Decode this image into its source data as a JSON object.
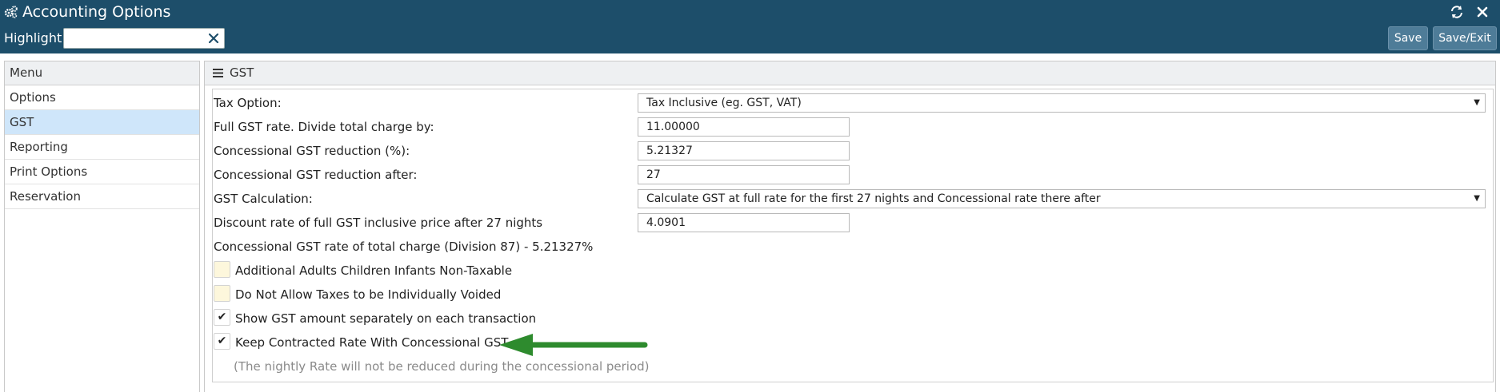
{
  "window": {
    "title": "Accounting Options",
    "title_icon": "gears-icon",
    "refresh_icon": "refresh-icon",
    "close_icon": "close-icon"
  },
  "toolbar": {
    "highlight_label": "Highlight:",
    "highlight_value": "",
    "save_label": "Save",
    "save_exit_label": "Save/Exit"
  },
  "menu": {
    "header": "Menu",
    "items": [
      {
        "label": "Options"
      },
      {
        "label": "GST"
      },
      {
        "label": "Reporting"
      },
      {
        "label": "Print Options"
      },
      {
        "label": "Reservation"
      }
    ],
    "active_index": 1
  },
  "gst": {
    "header": "GST",
    "tax_option": {
      "label": "Tax Option:",
      "value": "Tax Inclusive (eg. GST, VAT)"
    },
    "full_rate": {
      "label": "Full GST rate. Divide total charge by:",
      "value": "11.00000"
    },
    "concessional_reduction": {
      "label": "Concessional GST reduction (%):",
      "value": "5.21327"
    },
    "reduction_after": {
      "label": "Concessional GST reduction after:",
      "value": "27"
    },
    "calculation": {
      "label": "GST Calculation:",
      "value": "Calculate GST at full rate for the first 27 nights and Concessional rate there after"
    },
    "discount_rate": {
      "label": "Discount rate of full GST inclusive price after 27 nights",
      "value": "4.0901"
    },
    "concessional_rate_text": "Concessional GST rate of total charge (Division 87) - 5.21327%",
    "checkboxes": [
      {
        "label": "Additional Adults Children Infants Non-Taxable",
        "checked": false
      },
      {
        "label": "Do Not Allow Taxes to be Individually Voided",
        "checked": false
      },
      {
        "label": "Show GST amount separately on each transaction",
        "checked": true
      },
      {
        "label": "Keep Contracted Rate With Concessional GST",
        "checked": true
      }
    ],
    "note": "(The nightly Rate will not be reduced during the concessional period)"
  },
  "colors": {
    "topbar": "#1d4e6a",
    "button": "#4e7c98",
    "active_menu": "#cfe6fa",
    "unchecked_box": "#fdf7dc",
    "arrow": "#2e8b2e"
  }
}
